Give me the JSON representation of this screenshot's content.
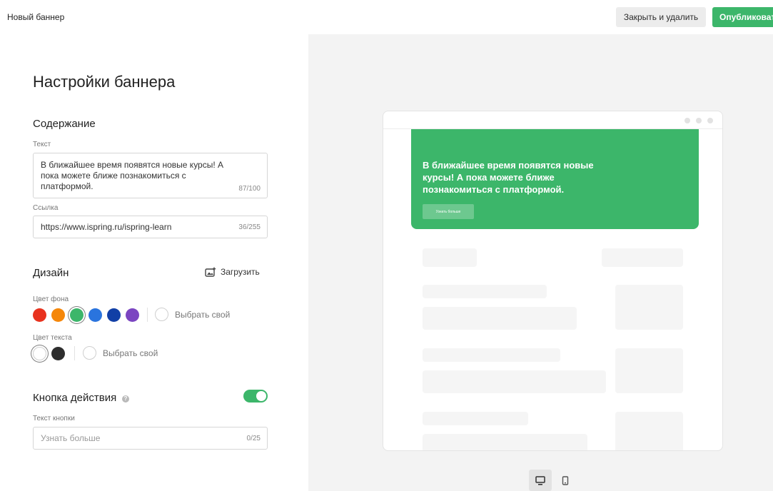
{
  "header": {
    "title": "Новый баннер",
    "close_label": "Закрыть и удалить",
    "publish_label": "Опубликовать"
  },
  "settings": {
    "title": "Настройки баннера",
    "content": {
      "heading": "Содержание",
      "text_label": "Текст",
      "text_line1": "В ближайшее время появятся новые курсы! А",
      "text_line2": "пока можете ближе познакомиться с",
      "text_line3": "платформой.",
      "text_counter": "87/100",
      "link_label": "Ссылка",
      "link_value": "https://www.ispring.ru/ispring-learn",
      "link_counter": "36/255"
    },
    "design": {
      "heading": "Дизайн",
      "upload_label": "Загрузить",
      "bg_color_label": "Цвет фона",
      "bg_colors": [
        "#e8321e",
        "#f5870a",
        "#3cb66a",
        "#2a74de",
        "#113fa6",
        "#7b45c1"
      ],
      "bg_selected": "#3cb66a",
      "bg_custom_label": "Выбрать свой",
      "text_color_label": "Цвет текста",
      "text_colors": [
        "#ffffff",
        "#2e2e2e"
      ],
      "text_selected": "#ffffff",
      "text_custom_label": "Выбрать свой"
    },
    "action": {
      "heading": "Кнопка действия",
      "help_icon": "?",
      "enabled": true,
      "button_text_label": "Текст кнопки",
      "button_text_placeholder": "Узнать больше",
      "button_text_counter": "0/25"
    }
  },
  "preview": {
    "banner_line1": "В ближайшее время появятся новые",
    "banner_line2": "курсы! А пока можете ближе",
    "banner_line3": "познакомиться с платформой.",
    "banner_button": "Узнать больше",
    "accent": "#3cb66a",
    "devices": [
      "desktop-icon",
      "mobile-icon"
    ],
    "active_device": "desktop"
  }
}
